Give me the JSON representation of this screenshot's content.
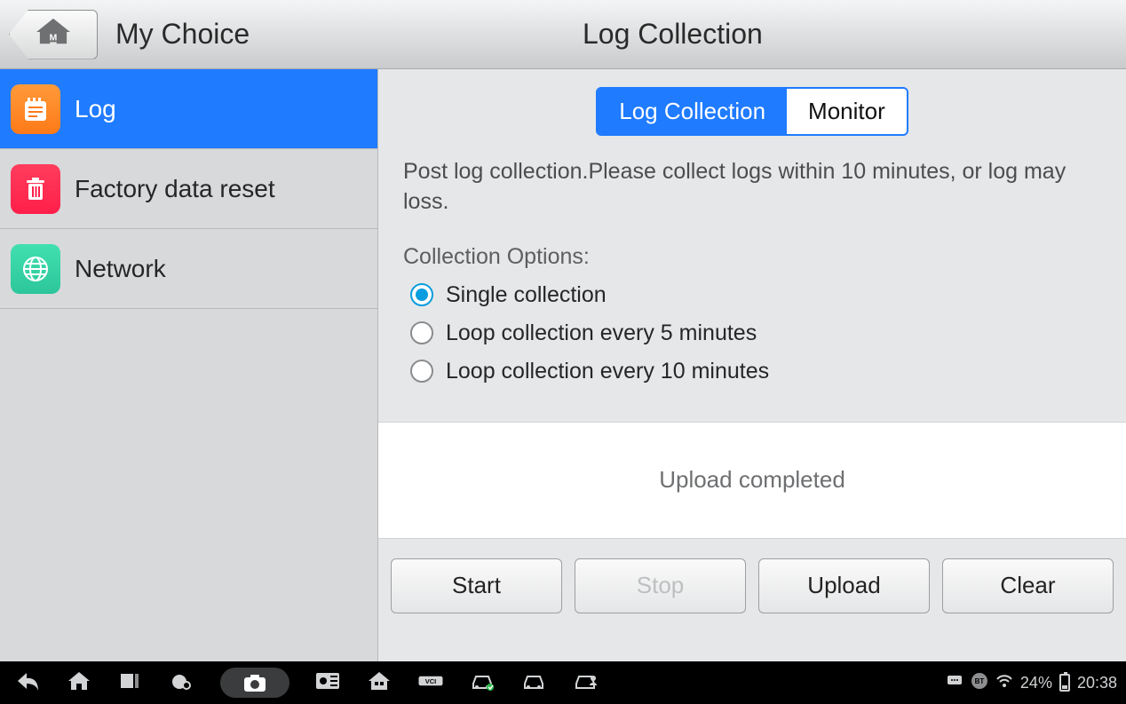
{
  "header": {
    "left_title": "My Choice",
    "right_title": "Log Collection"
  },
  "sidebar": {
    "items": [
      {
        "label": "Log",
        "icon": "notepad-icon",
        "active": true
      },
      {
        "label": "Factory data reset",
        "icon": "trash-icon",
        "active": false
      },
      {
        "label": "Network",
        "icon": "globe-icon",
        "active": false
      }
    ]
  },
  "tabs": {
    "items": [
      {
        "label": "Log Collection",
        "active": true
      },
      {
        "label": "Monitor",
        "active": false
      }
    ]
  },
  "description": "Post log collection.Please collect logs within 10 minutes, or log may loss.",
  "options": {
    "title": "Collection Options:",
    "items": [
      {
        "label": "Single collection",
        "checked": true
      },
      {
        "label": "Loop collection every 5 minutes",
        "checked": false
      },
      {
        "label": "Loop collection every 10 minutes",
        "checked": false
      }
    ]
  },
  "status": "Upload completed",
  "actions": {
    "start": "Start",
    "stop": "Stop",
    "upload": "Upload",
    "clear": "Clear"
  },
  "navbar": {
    "battery_pct": "24%",
    "clock": "20:38",
    "bt_label": "BT"
  }
}
